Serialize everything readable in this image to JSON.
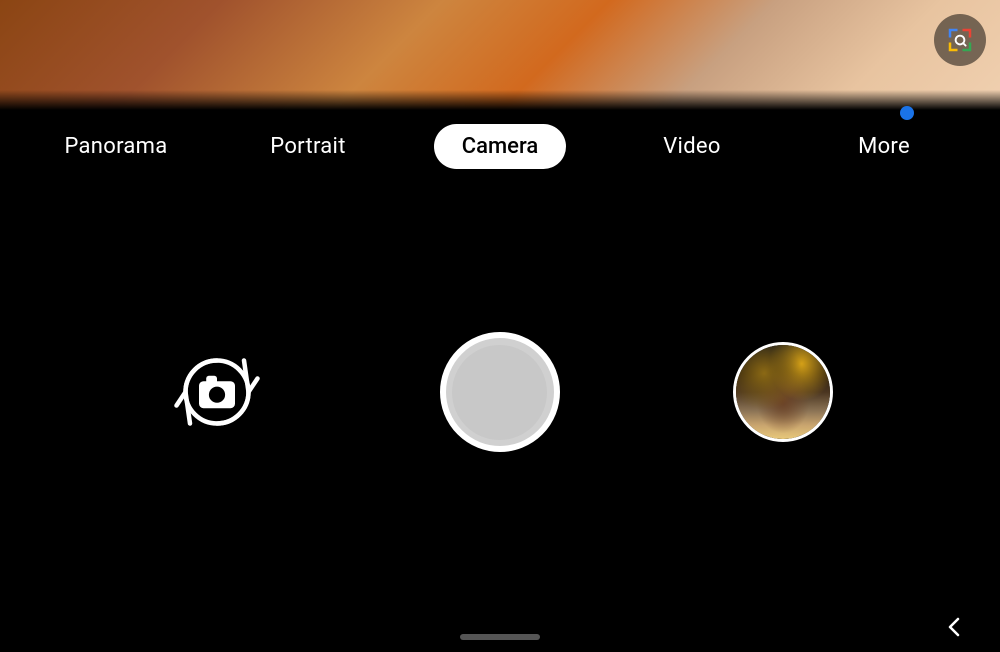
{
  "viewfinder": {
    "alt": "Camera viewfinder showing blurred background"
  },
  "lens_button": {
    "label": "Google Lens",
    "icon": "lens-search-icon"
  },
  "mode_bar": {
    "modes": [
      {
        "id": "panorama",
        "label": "Panorama",
        "active": false
      },
      {
        "id": "portrait",
        "label": "Portrait",
        "active": false
      },
      {
        "id": "camera",
        "label": "Camera",
        "active": true
      },
      {
        "id": "video",
        "label": "Video",
        "active": false
      },
      {
        "id": "more",
        "label": "More",
        "active": false,
        "has_dot": true
      }
    ]
  },
  "controls": {
    "flip_button_label": "Flip camera",
    "shutter_button_label": "Take photo",
    "gallery_button_label": "View gallery"
  },
  "bottom": {
    "back_label": "Back"
  }
}
